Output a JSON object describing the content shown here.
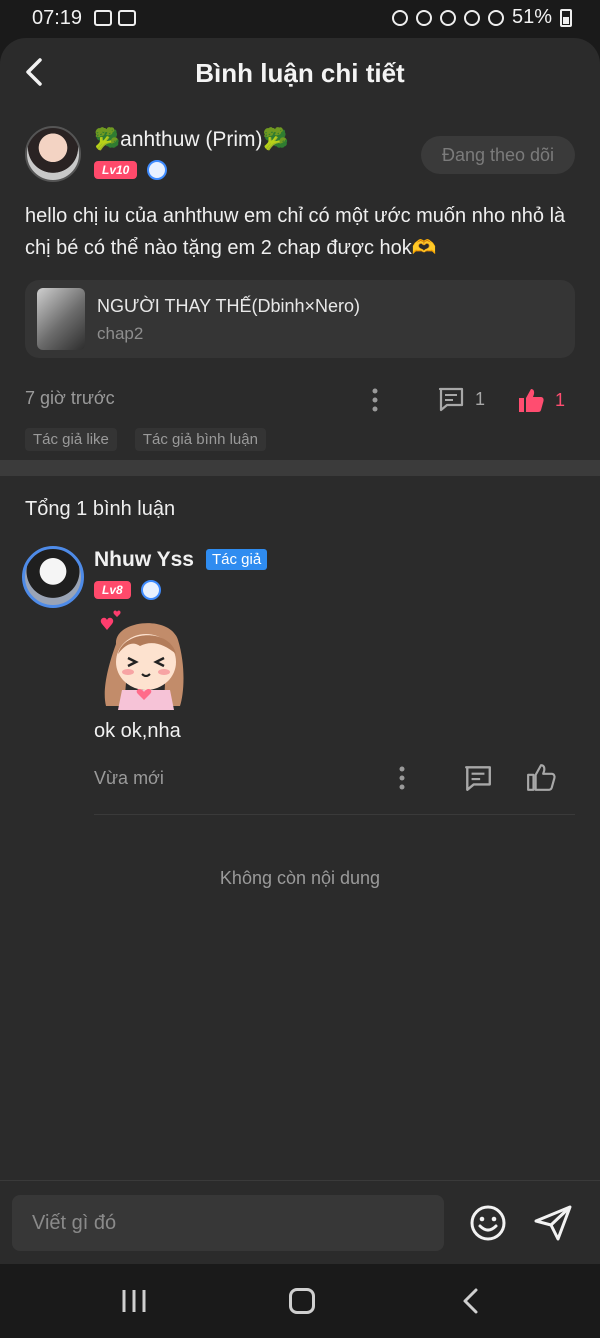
{
  "status_bar": {
    "time": "07:19",
    "battery": "51%"
  },
  "header": {
    "title": "Bình luận chi tiết"
  },
  "post": {
    "author_name": "🥦anhthuw (Prim)🥦",
    "level": "Lv10",
    "follow_label": "Đang theo dõi",
    "text": "hello chị iu của anhthuw em chỉ có một ước muốn nho nhỏ là chị bé có thể nào tặng em 2 chap được hok🫶",
    "story": {
      "title": "NGƯỜI THAY THẾ(Dbinh×Nero)",
      "chapter": "chap2"
    },
    "time": "7 giờ trước",
    "comment_count": "1",
    "like_count": "1",
    "tags": [
      "Tác giả like",
      "Tác giả bình luận"
    ]
  },
  "comments_section": {
    "total_label": "Tổng 1 bình luận",
    "end_label": "Không còn nội dung"
  },
  "comment": {
    "author_name": "Nhuw Yss",
    "author_badge": "Tác giả",
    "level": "Lv8",
    "text": "ok ok,nha",
    "time": "Vừa mới"
  },
  "composer": {
    "placeholder": "Viết gì đó"
  },
  "colors": {
    "background": "#2b2b2b",
    "like_accent": "#ff4d70",
    "author_badge": "#2f8cf0",
    "level_badge": "#ff4a6b"
  },
  "icons": [
    "back-icon",
    "more-dots-icon",
    "comment-icon",
    "like-icon",
    "emoji-icon",
    "send-icon"
  ]
}
